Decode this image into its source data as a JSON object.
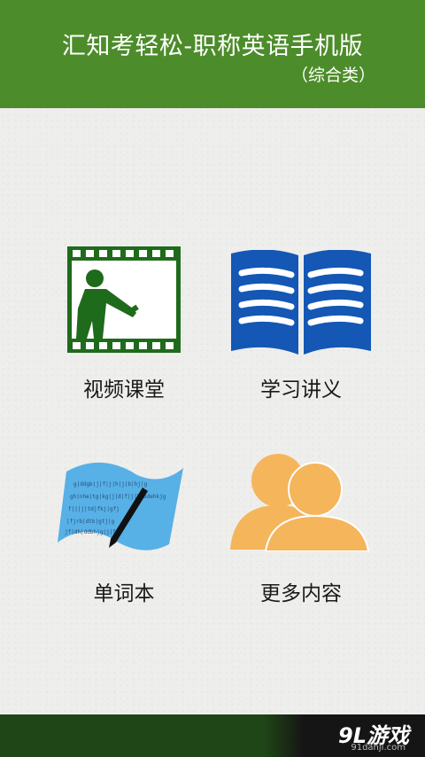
{
  "header": {
    "title": "汇知考轻松-职称英语手机版",
    "subtitle": "（综合类）"
  },
  "tiles": [
    {
      "label": "视频课堂",
      "icon": "film-lecture-icon"
    },
    {
      "label": "学习讲义",
      "icon": "open-book-icon"
    },
    {
      "label": "单词本",
      "icon": "wordbook-pen-icon"
    },
    {
      "label": "更多内容",
      "icon": "people-icon"
    }
  ],
  "wordbook_lines": [
    "g|ddgb|j|f|j|h|j|b|hj|g",
    "gh|nhe|tg|kg|j|d|f|j|h|bdehkjg",
    "f|||j|tdjfkj|gfj",
    "|fjrb|dtk|gtj|g",
    "jf|dh|ddbhjg|j|f"
  ],
  "colors": {
    "header": "#4c8c2a",
    "footer": "#1f4616",
    "film": "#1f6b1c",
    "book": "#1457b5",
    "wordbook": "#57b0e6",
    "people": "#f5b55a"
  },
  "footer": {
    "brand": "9L游戏",
    "brand_sub": "91danji.com"
  }
}
